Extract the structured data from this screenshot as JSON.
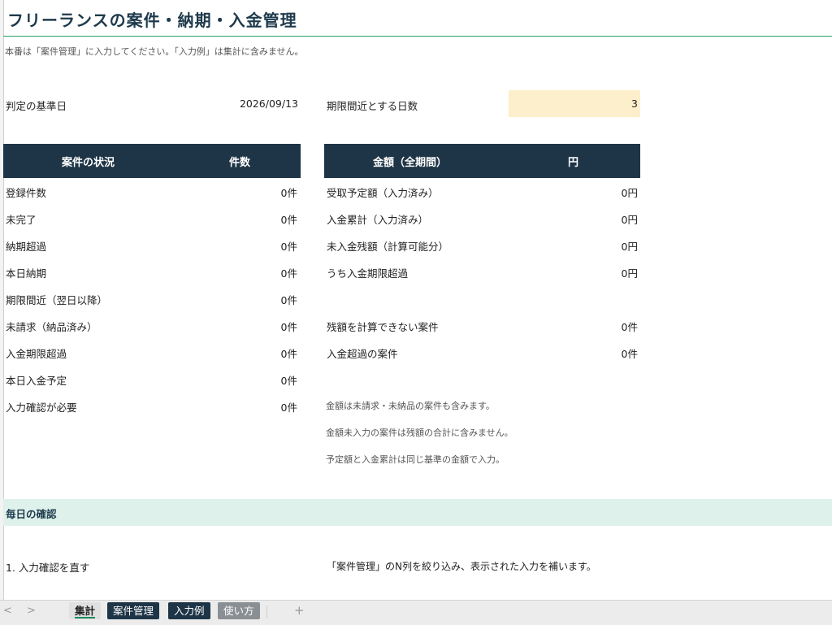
{
  "title": "フリーランスの案件・納期・入金管理",
  "note": "本番は「案件管理」に入力してください。「入力例」は集計に含みません。",
  "base_date": {
    "label": "判定の基準日",
    "value": "2026/09/13"
  },
  "deadline_days": {
    "label": "期限間近とする日数",
    "value": "3"
  },
  "status_table": {
    "header": {
      "col1": "案件の状況",
      "col2": "件数"
    },
    "rows": [
      {
        "label": "登録件数",
        "value": "0件"
      },
      {
        "label": "未完了",
        "value": "0件"
      },
      {
        "label": "納期超過",
        "value": "0件"
      },
      {
        "label": "本日納期",
        "value": "0件"
      },
      {
        "label": "期限間近（翌日以降）",
        "value": "0件"
      },
      {
        "label": "未請求（納品済み）",
        "value": "0件"
      },
      {
        "label": "入金期限超過",
        "value": "0件"
      },
      {
        "label": "本日入金予定",
        "value": "0件"
      },
      {
        "label": "入力確認が必要",
        "value": "0件"
      }
    ]
  },
  "amount_table": {
    "header": {
      "col1": "金額（全期間）",
      "col2": "円"
    },
    "rows": [
      {
        "label": "受取予定額（入力済み）",
        "value": "0円"
      },
      {
        "label": "入金累計（入力済み）",
        "value": "0円"
      },
      {
        "label": "未入金残額（計算可能分）",
        "value": "0円"
      },
      {
        "label": "うち入金期限超過",
        "value": "0円"
      }
    ],
    "extra_rows": [
      {
        "label": "残額を計算できない案件",
        "value": "0件"
      },
      {
        "label": "入金超過の案件",
        "value": "0件"
      }
    ],
    "notes": [
      "金額は未請求・未納品の案件も含みます。",
      "金額未入力の案件は残額の合計に含みません。",
      "予定額と入金累計は同じ基準の金額で入力。"
    ]
  },
  "daily_section": {
    "title": "毎日の確認",
    "item1": {
      "label": "1. 入力確認を直す",
      "desc": "「案件管理」のN列を絞り込み、表示された入力を補います。"
    }
  },
  "tabs": {
    "prev_icon": "chevron-left-icon",
    "next_icon": "chevron-right-icon",
    "prev": "<",
    "next": ">",
    "items": [
      "集計",
      "案件管理",
      "入力例",
      "使い方"
    ],
    "add": "+"
  },
  "colors": {
    "header_bg": "#1e3547",
    "highlight_bg": "#fdefcc",
    "band_bg": "#def2eb",
    "title_rule": "#27a06b"
  }
}
